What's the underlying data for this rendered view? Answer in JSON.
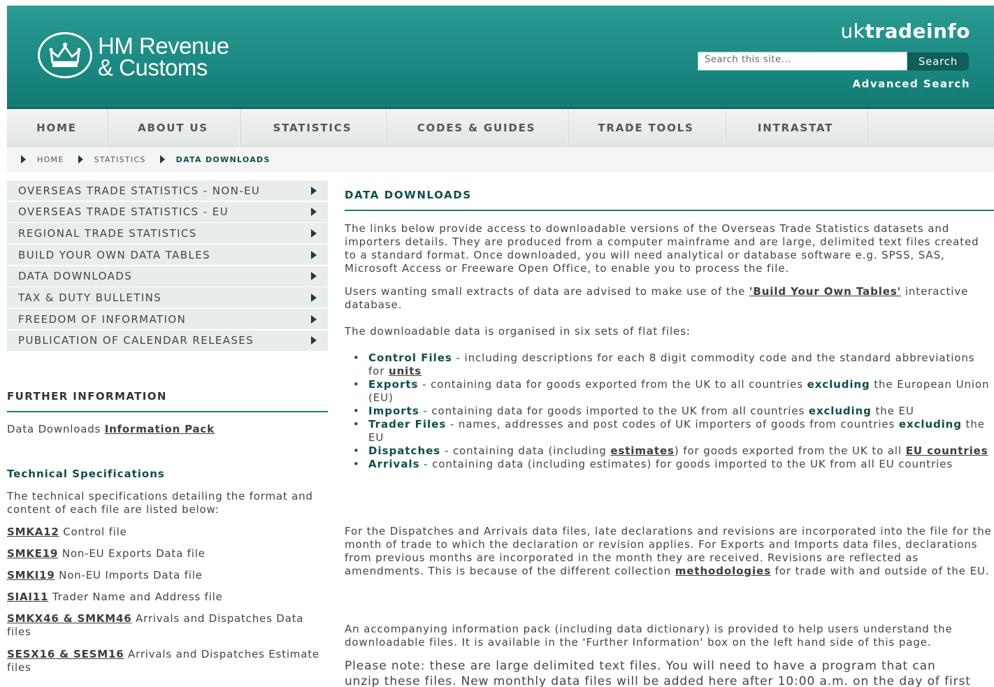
{
  "header": {
    "logo_line1": "HM Revenue",
    "logo_line2": "& Customs",
    "site_name_a": "uk",
    "site_name_b": "tradeinfo",
    "search_placeholder": "Search this site...",
    "search_button": "Search",
    "advanced_search": "Advanced Search",
    "colors": {
      "teal": "#1b8a82",
      "dark_teal": "#0e4f4a"
    }
  },
  "nav": [
    "HOME",
    "ABOUT US",
    "STATISTICS",
    "CODES & GUIDES",
    "TRADE TOOLS",
    "INTRASTAT"
  ],
  "breadcrumb": [
    "HOME",
    "STATISTICS",
    "DATA DOWNLOADS"
  ],
  "leftmenu": [
    "OVERSEAS TRADE STATISTICS - NON-EU",
    "OVERSEAS TRADE STATISTICS - EU",
    "REGIONAL TRADE STATISTICS",
    "BUILD YOUR OWN DATA TABLES",
    "DATA DOWNLOADS",
    "TAX & DUTY BULLETINS",
    "FREEDOM OF INFORMATION",
    "PUBLICATION OF CALENDAR RELEASES"
  ],
  "further": {
    "title": "FURTHER INFORMATION",
    "text": "Data Downloads ",
    "link": "Information Pack"
  },
  "tech": {
    "title": "Technical Specifications",
    "desc": "The technical specifications detailing the format and content of each file are listed below:",
    "items": [
      {
        "code": "SMKA12",
        "desc": " Control file"
      },
      {
        "code": "SMKE19",
        "desc": " Non-EU Exports Data file"
      },
      {
        "code": "SMKI19",
        "desc": " Non-EU Imports Data file"
      },
      {
        "code": "SIAI11",
        "desc": " Trader Name and Address file"
      },
      {
        "code": "SMKX46 & SMKM46",
        "desc": " Arrivals and Dispatches Data files"
      },
      {
        "code": "SESX16 & SESM16",
        "desc": " Arrivals and Dispatches Estimate files"
      }
    ]
  },
  "main": {
    "title": "DATA DOWNLOADS",
    "p1": "The links below provide access to downloadable versions of the Overseas Trade Statistics datasets and importers details. They are produced from a computer mainframe and are large, delimited text files created to a standard format. Once downloaded, you will need analytical or database software e.g. SPSS, SAS, Microsoft Access or Freeware Open Office, to enable you to process the file.",
    "p2_a": "Users wanting small extracts of data are advised to make use of the ",
    "p2_link": "'Build Your Own Tables'",
    "p2_b": " interactive database.",
    "p3": "The downloadable data is organised in six sets of flat files:",
    "b1_term": "Control Files",
    "b1_text": " - including descriptions for each 8 digit commodity code and the standard abbreviations for ",
    "b1_link": "units",
    "b2_term": "Exports",
    "b2_text_a": " - containing data for goods exported from the UK to all countries ",
    "b2_em": "excluding",
    "b2_text_b": " the European Union (EU)",
    "b3_term": "Imports",
    "b3_text_a": " - containing data for goods imported to the UK from all countries ",
    "b3_em": "excluding",
    "b3_text_b": " the EU",
    "b4_term": "Trader Files",
    "b4_text_a": " - names, addresses and post codes of UK importers of goods from countries ",
    "b4_em": "excluding",
    "b4_text_b": " the EU",
    "b5_term": "Dispatches",
    "b5_text_a": " - containing data (including ",
    "b5_link1": "estimates",
    "b5_text_b": ") for goods exported from the UK to all ",
    "b5_link2": "EU countries",
    "b6_term": "Arrivals",
    "b6_text": " - containing data (including estimates) for goods imported to the UK from all EU countries",
    "p4_a": "For the Dispatches and Arrivals data files, late declarations and revisions are incorporated into the file for the month of trade to which the declaration or revision applies. For Exports and Imports data files, declarations from previous months are incorporated in the month they are received. Revisions are reflected as amendments. This is because of the different collection ",
    "p4_link": "methodologies",
    "p4_b": " for trade with and outside of the EU.",
    "p5": "An accompanying information pack (including data dictionary) is provided to help users understand the downloadable files. It is available in the 'Further Information' box on the left hand side of this page.",
    "note_line1": "Please note: these are large delimited text files. You will need to have a program that can",
    "note_line2": "unzip these files. New monthly data files will be added here after 10:00 a.m. on the day of first"
  }
}
